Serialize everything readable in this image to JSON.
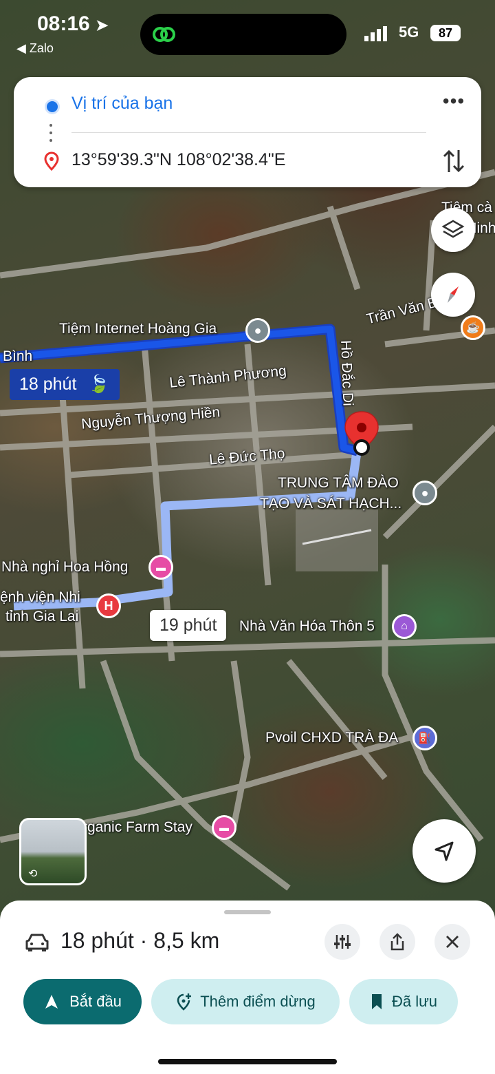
{
  "status_bar": {
    "time": "08:16",
    "back_app": "◀ Zalo",
    "network": "5G",
    "battery": "87"
  },
  "directions": {
    "from": "Vị trí của bạn",
    "to": "13°59'39.3\"N 108°02'38.4\"E"
  },
  "map": {
    "roads": {
      "tran_van_b": "Trần Văn B",
      "ho_dac_di": "Hồ Đắc Di",
      "le_thanh_phuong": "Lê Thành Phương",
      "nguyen_thuong_hien": "Nguyễn Thượng Hiền",
      "le_duc_tho": "Lê Đức Thọ",
      "binh": "Bình"
    },
    "places": {
      "internet": "Tiệm Internet Hoàng Gia",
      "training_line1": "TRUNG TÂM ĐÀO",
      "training_line2": "TẠO VÀ SÁT HẠCH...",
      "hotel": "Nhà nghỉ Hoa Hồng",
      "hospital_line1": "ệnh viện Nhi",
      "hospital_line2": "tỉnh Gia Lai",
      "culture": "Nhà Văn Hóa Thôn 5",
      "fuel": "Pvoil CHXD TRÀ ĐA",
      "farmstay": "rganic Farm Stay",
      "top_right_line1": "Tiệm cà",
      "top_right_line2": "Minh"
    },
    "route_time_primary": "18 phút",
    "route_time_alt": "19 phút",
    "colors": {
      "route": "#1a56e8",
      "alt_route": "#9bb7f5",
      "destination": "#e8312f"
    }
  },
  "sheet": {
    "summary": "18 phút · 8,5 km",
    "start": "Bắt đầu",
    "add_stop": "Thêm điểm dừng",
    "saved": "Đã lưu"
  },
  "icons": [
    "location-arrow-icon",
    "layers-icon",
    "compass-icon",
    "car-icon",
    "filter-icon",
    "share-icon",
    "close-icon",
    "navigation-icon",
    "bookmark-icon",
    "add-location-icon"
  ]
}
